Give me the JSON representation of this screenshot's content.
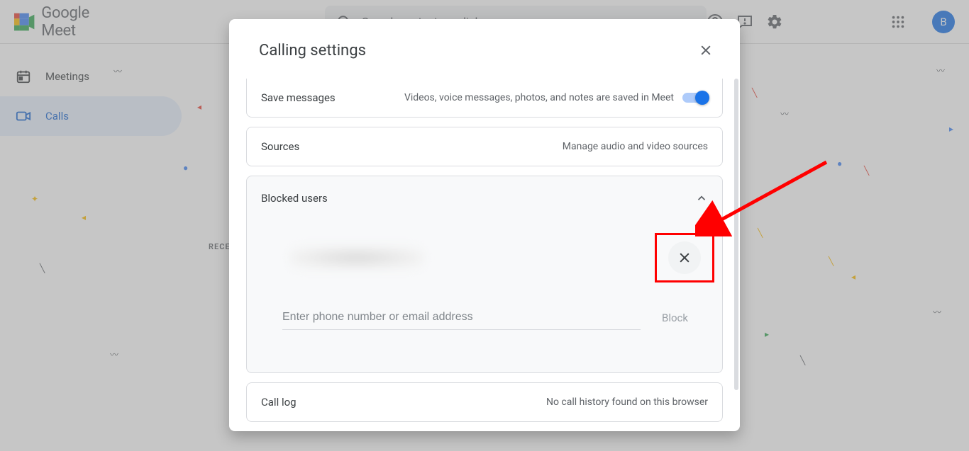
{
  "app": {
    "name": "Google Meet"
  },
  "header": {
    "search_placeholder": "Search contacts or dial",
    "avatar_initial": "B"
  },
  "sidebar": {
    "items": [
      {
        "label": "Meetings"
      },
      {
        "label": "Calls"
      }
    ]
  },
  "main": {
    "section_label": "RECE"
  },
  "modal": {
    "title": "Calling settings",
    "save_messages": {
      "label": "Save messages",
      "description": "Videos, voice messages, photos, and notes are saved in Meet",
      "enabled": true
    },
    "sources": {
      "label": "Sources",
      "action": "Manage audio and video sources"
    },
    "blocked_users": {
      "label": "Blocked users",
      "input_placeholder": "Enter phone number or email address",
      "block_button": "Block"
    },
    "call_log": {
      "label": "Call log",
      "description": "No call history found on this browser"
    }
  }
}
